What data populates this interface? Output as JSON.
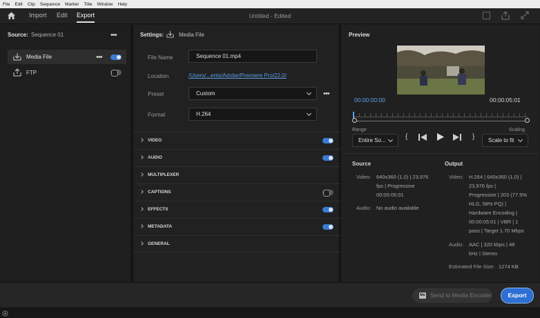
{
  "menu": [
    "File",
    "Edit",
    "Clip",
    "Sequence",
    "Marker",
    "Title",
    "Window",
    "Help"
  ],
  "tabs": {
    "import": "Import",
    "edit": "Edit",
    "export": "Export"
  },
  "title": "Untitled  -  Edited",
  "source_panel": {
    "label": "Source:",
    "sequence": "Sequence 01",
    "destinations": [
      {
        "label": "Media File",
        "enabled": true
      },
      {
        "label": "FTP",
        "enabled": false
      }
    ]
  },
  "settings": {
    "label": "Settings:",
    "target": "Media File",
    "file_name_label": "File Name",
    "file_name": "Sequence 01.mp4",
    "location_label": "Location",
    "location": "/Users/...ents/Adobe/Premiere Pro/22.0/",
    "preset_label": "Preset",
    "preset": "Custom",
    "format_label": "Format",
    "format": "H.264",
    "sections": [
      {
        "name": "VIDEO",
        "enabled": true,
        "has_toggle": true
      },
      {
        "name": "AUDIO",
        "enabled": true,
        "has_toggle": true
      },
      {
        "name": "MULTIPLEXER",
        "enabled": false,
        "has_toggle": false
      },
      {
        "name": "CAPTIONS",
        "enabled": false,
        "has_toggle": true
      },
      {
        "name": "EFFECTS",
        "enabled": true,
        "has_toggle": true
      },
      {
        "name": "METADATA",
        "enabled": true,
        "has_toggle": true
      },
      {
        "name": "GENERAL",
        "enabled": false,
        "has_toggle": false
      }
    ]
  },
  "preview": {
    "label": "Preview",
    "timecode_current": "00:00:00:00",
    "timecode_end": "00:00:05:01",
    "range_label": "Range",
    "range_value": "Entire So...",
    "scaling_label": "Scaling",
    "scaling_value": "Scale to fit"
  },
  "source_info": {
    "heading": "Source",
    "video_label": "Video:",
    "video_lines": [
      "640x360 (1,0)  |  23,976",
      "fps  |  Progressive",
      "00:00:05:01"
    ],
    "audio_label": "Audio:",
    "audio_lines": [
      "No audio available"
    ]
  },
  "output_info": {
    "heading": "Output",
    "video_label": "Video:",
    "video_lines": [
      "H.264  |  640x360 (1,0)  |",
      "23,976 fps  |",
      "Progressive  |  203 (77.5%",
      "HLG, 58% PQ)  |",
      "Hardware Encoding  |",
      "00:00:05:01  |  VBR  |  1",
      "pass  |  Target 1.70 Mbps"
    ],
    "audio_label": "Audio:",
    "audio_lines": [
      "AAC  |  320 kbps  |  48",
      "kHz  |  Stereo"
    ],
    "file_size_label": "Estimated File Size:",
    "file_size": "1274 KB"
  },
  "footer": {
    "send_label": "Send to Media Encoder",
    "send_badge": "Me",
    "export_label": "Export"
  },
  "colors": {
    "accent": "#3a7bd5",
    "timecode": "#5da3f0",
    "link": "#5b9be0"
  }
}
